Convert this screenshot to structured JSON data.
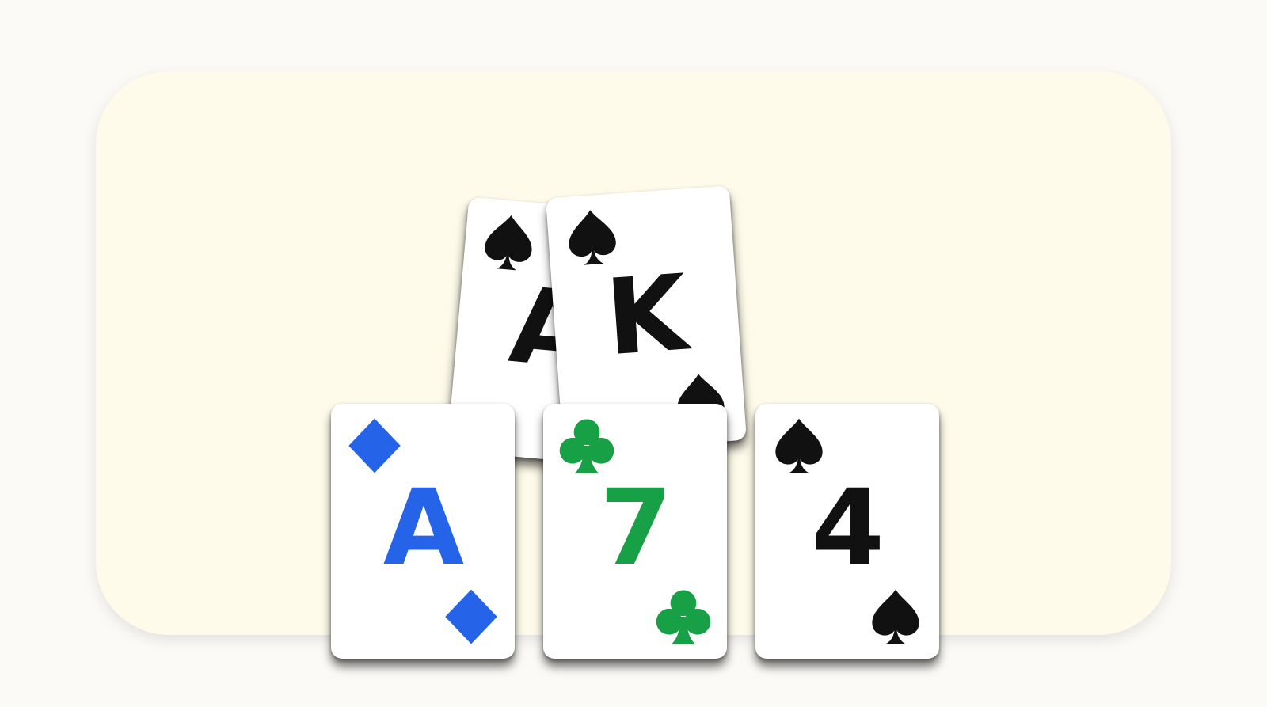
{
  "colors": {
    "spades": "#111111",
    "diamonds": "#2563e8",
    "clubs": "#17a045",
    "hearts": "#e02424"
  },
  "hole_cards": [
    {
      "rank": "A",
      "suit": "spades",
      "suit_icon": "spade-icon"
    },
    {
      "rank": "K",
      "suit": "spades",
      "suit_icon": "spade-icon"
    }
  ],
  "board_cards": [
    {
      "rank": "A",
      "suit": "diamonds",
      "suit_icon": "diamond-icon"
    },
    {
      "rank": "7",
      "suit": "clubs",
      "suit_icon": "club-icon"
    },
    {
      "rank": "4",
      "suit": "spades",
      "suit_icon": "spade-icon"
    }
  ]
}
